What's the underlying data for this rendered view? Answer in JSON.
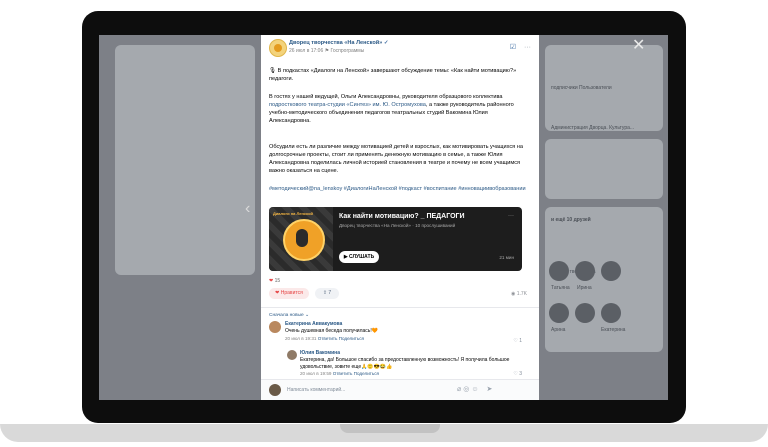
{
  "post": {
    "author": "Дворец творчества «На Ленской»",
    "verified_mark": "✓",
    "date": "26 июл в 17:06",
    "geo": "Госпрограммы",
    "intro": "🎙 В подкастах «Диалоги на Ленской» завершают обсуждение темы: «Как найти мотивацию?» педагоги.",
    "p2_a": "В гостях у нашей ведущей, Ольги Александровны, руководителя образцового коллектива ",
    "p2_link": "подросткового театра-студии «Синтез» им. Ю. Остромухова",
    "p2_b": ", а также руководитель районного учебно-методического объединения педагогов театральных студий Вакомина Юлия Александровна.",
    "p3": "Обсудили есть ли различие между мотивацией детей и взрослых, как мотивировать учащихся на долгосрочные проекты, стоит ли применять денежную мотивацию в семье, а также Юлия Александровна поделилась личной историей становления в театре и почему не всем учащимся важно оказаться на сцене.",
    "tags": "#методический@na_lenskoy #ДиалогиНаЛенской #подкаст #воспитание #инновациивобразовании"
  },
  "podcast": {
    "cover_label": "Диалоги на Ленской",
    "title": "Как найти мотивацию? _ ПЕДАГОГИ",
    "subtitle": "Дворец творчества «На Ленской» · 10 прослушиваний",
    "listen": "▶ СЛУШАТЬ",
    "duration": "21 мин",
    "more": "···"
  },
  "stats": {
    "reactions": "15",
    "like_label": "Нравится",
    "shares": "7",
    "views": "1.7K"
  },
  "comments": {
    "sort": "Сначала новые ⌄",
    "items": [
      {
        "name": "Екатерина Аввакумова",
        "text": "Очень душевная беседа получилась!🧡",
        "date": "20 июл в 19:31",
        "reply": "Ответить",
        "share": "Поделиться",
        "likes": "1"
      },
      {
        "name": "Юлия Вакомина",
        "text": "Екатерина, да! Большое спасибо за предоставленную возможность! Я получила большое удовольствие, зовите еще🙏🙂😎😂👍",
        "date": "20 июл в 19:59",
        "reply": "Ответить",
        "share": "Поделиться",
        "likes": "3"
      }
    ],
    "placeholder": "Написать комментарий..."
  },
  "bg": {
    "side_text_1": "подписчики Пользователи",
    "side_text_2": "Администрация Дворца. Культура...",
    "side_text_3": "и ещё 10 друзей",
    "side_text_4": "Дворец творчества",
    "friend_1": "Татьяна",
    "friend_2": "Ирина",
    "friend_3": "Арина",
    "friend_4": "Екатерина"
  }
}
